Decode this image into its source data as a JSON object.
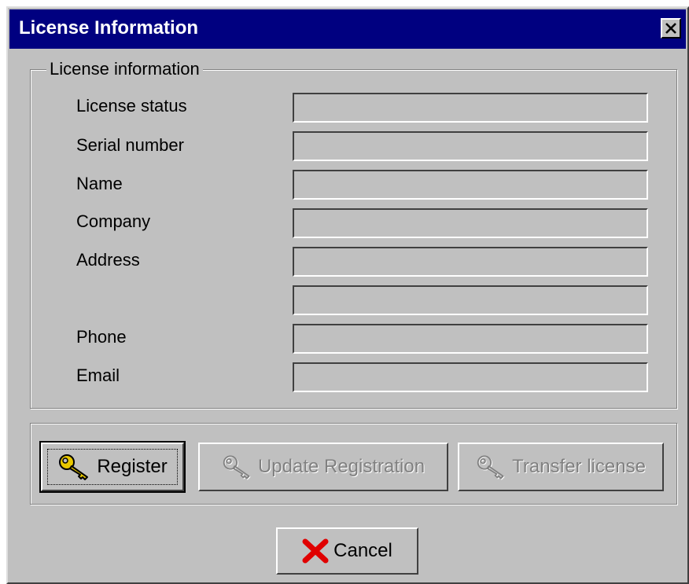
{
  "window": {
    "title": "License Information",
    "close_icon": "close-icon"
  },
  "license_group": {
    "legend": "License information",
    "fields": [
      {
        "label": "License status",
        "value": ""
      },
      {
        "label": "Serial number",
        "value": ""
      },
      {
        "label": "Name",
        "value": ""
      },
      {
        "label": "Company",
        "value": ""
      },
      {
        "label": "Address",
        "value": ""
      },
      {
        "label": "",
        "value": ""
      },
      {
        "label": "Phone",
        "value": ""
      },
      {
        "label": "Email",
        "value": ""
      }
    ]
  },
  "actions": {
    "register_label": "Register",
    "register_icon": "key-icon",
    "update_label": "Update Registration",
    "update_icon": "key-icon",
    "transfer_label": "Transfer license",
    "transfer_icon": "key-icon"
  },
  "footer": {
    "cancel_label": "Cancel",
    "cancel_icon": "red-x-icon"
  },
  "colors": {
    "titlebar": "#000080",
    "face": "#c0c0c0",
    "key_gold": "#e8c800",
    "cancel_red": "#e00000"
  }
}
